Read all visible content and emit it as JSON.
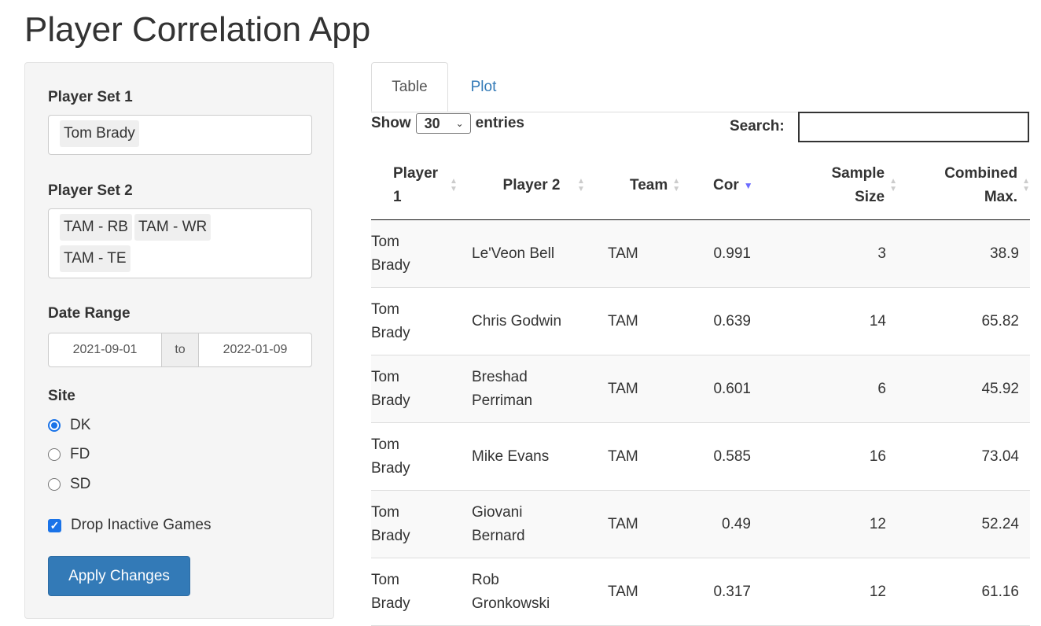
{
  "app": {
    "title": "Player Correlation App"
  },
  "sidebar": {
    "player_set_1": {
      "label": "Player Set 1",
      "selected": [
        "Tom Brady"
      ]
    },
    "player_set_2": {
      "label": "Player Set 2",
      "selected": [
        "TAM - RB",
        "TAM - WR",
        "TAM - TE"
      ]
    },
    "date_range": {
      "label": "Date Range",
      "start": "2021-09-01",
      "separator": "to",
      "end": "2022-01-09"
    },
    "site": {
      "label": "Site",
      "options": [
        {
          "label": "DK",
          "checked": true
        },
        {
          "label": "FD",
          "checked": false
        },
        {
          "label": "SD",
          "checked": false
        }
      ]
    },
    "drop_inactive": {
      "label": "Drop Inactive Games",
      "checked": true
    },
    "apply_label": "Apply Changes"
  },
  "tabs": [
    {
      "label": "Table",
      "active": true
    },
    {
      "label": "Plot",
      "active": false
    }
  ],
  "table_controls": {
    "show_label": "Show",
    "entries_value": "30",
    "entries_label": "entries",
    "search_label": "Search:",
    "search_value": ""
  },
  "table": {
    "columns": [
      "Player 1",
      "Player 2",
      "Team",
      "Cor",
      "Sample Size",
      "Combined Max."
    ],
    "sorted_column": "Cor",
    "rows": [
      {
        "player1": "Tom Brady",
        "player2": "Le'Veon Bell",
        "team": "TAM",
        "cor": "0.991",
        "sample": "3",
        "max": "38.9"
      },
      {
        "player1": "Tom Brady",
        "player2": "Chris Godwin",
        "team": "TAM",
        "cor": "0.639",
        "sample": "14",
        "max": "65.82"
      },
      {
        "player1": "Tom Brady",
        "player2": "Breshad Perriman",
        "team": "TAM",
        "cor": "0.601",
        "sample": "6",
        "max": "45.92"
      },
      {
        "player1": "Tom Brady",
        "player2": "Mike Evans",
        "team": "TAM",
        "cor": "0.585",
        "sample": "16",
        "max": "73.04"
      },
      {
        "player1": "Tom Brady",
        "player2": "Giovani Bernard",
        "team": "TAM",
        "cor": "0.49",
        "sample": "12",
        "max": "52.24"
      },
      {
        "player1": "Tom Brady",
        "player2": "Rob Gronkowski",
        "team": "TAM",
        "cor": "0.317",
        "sample": "12",
        "max": "61.16"
      }
    ]
  }
}
